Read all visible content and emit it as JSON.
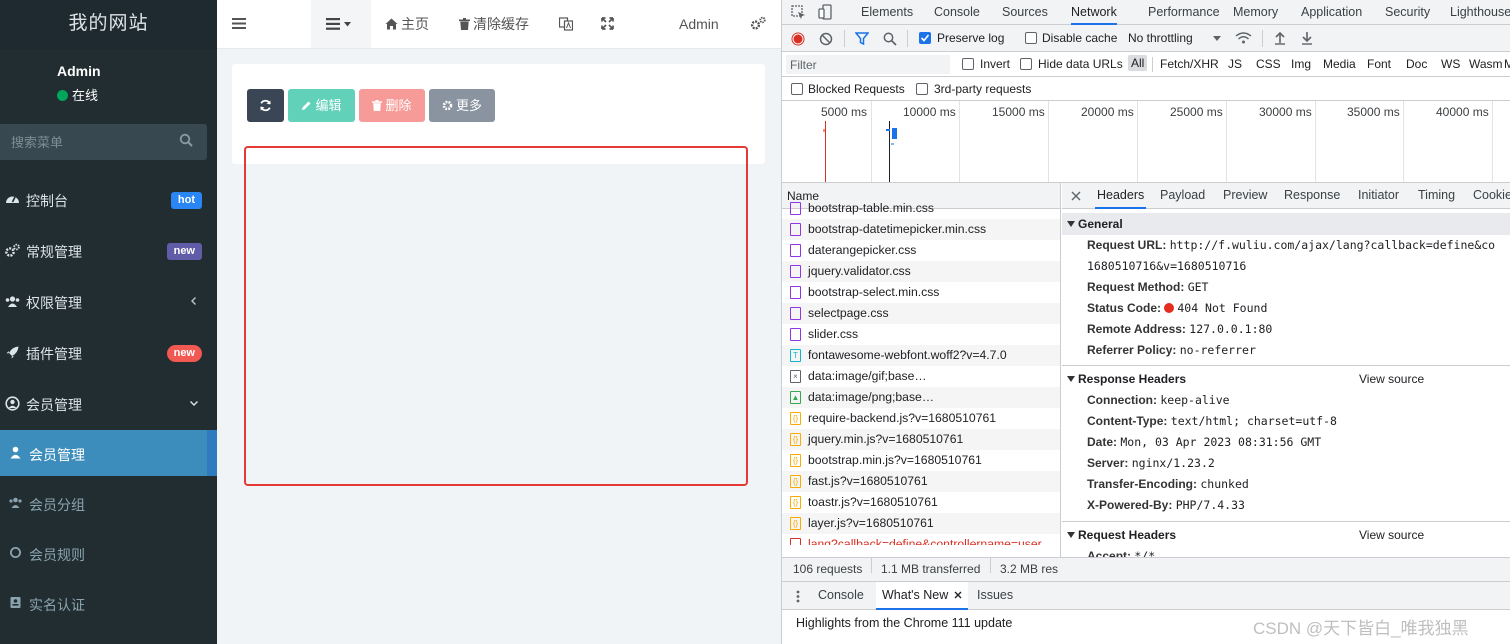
{
  "sidebar": {
    "logo": "我的网站",
    "user": {
      "name": "Admin",
      "status": "在线"
    },
    "search_placeholder": "搜索菜单",
    "items": [
      {
        "label": "控制台",
        "badge": "hot",
        "badge_color": "#2b86f5"
      },
      {
        "label": "常规管理",
        "badge": "new",
        "badge_color": "#605ca8"
      },
      {
        "label": "权限管理"
      },
      {
        "label": "插件管理",
        "badge": "new",
        "badge_color": "#f15952"
      },
      {
        "label": "会员管理"
      }
    ],
    "subitems": [
      {
        "label": "会员管理"
      },
      {
        "label": "会员分组"
      },
      {
        "label": "会员规则"
      },
      {
        "label": "实名认证"
      }
    ]
  },
  "topnav": {
    "home": "主页",
    "clear_cache": "清除缓存",
    "admin": "Admin"
  },
  "toolbar": {
    "edit": "编辑",
    "delete": "删除",
    "more": "更多"
  },
  "devtools": {
    "tabs": [
      "Elements",
      "Console",
      "Sources",
      "Network",
      "Performance",
      "Memory",
      "Application",
      "Security",
      "Lighthouse"
    ],
    "active_tab": "Network",
    "toolbar": {
      "preserve_log": "Preserve log",
      "disable_cache": "Disable cache",
      "throttling": "No throttling"
    },
    "filter": {
      "placeholder": "Filter",
      "invert": "Invert",
      "hide_data_urls": "Hide data URLs",
      "types": [
        "All",
        "Fetch/XHR",
        "JS",
        "CSS",
        "Img",
        "Media",
        "Font",
        "Doc",
        "WS",
        "Wasm",
        "Ma"
      ],
      "blocked": "Blocked Requests",
      "third_party": "3rd-party requests"
    },
    "timeline": [
      "5000 ms",
      "10000 ms",
      "15000 ms",
      "20000 ms",
      "25000 ms",
      "30000 ms",
      "35000 ms",
      "40000 ms"
    ],
    "requests_header": "Name",
    "requests": [
      {
        "name": "bootstrap-table.min.css",
        "kind": "css"
      },
      {
        "name": "bootstrap-datetimepicker.min.css",
        "kind": "css"
      },
      {
        "name": "daterangepicker.css",
        "kind": "css"
      },
      {
        "name": "jquery.validator.css",
        "kind": "css"
      },
      {
        "name": "bootstrap-select.min.css",
        "kind": "css"
      },
      {
        "name": "selectpage.css",
        "kind": "css"
      },
      {
        "name": "slider.css",
        "kind": "css"
      },
      {
        "name": "fontawesome-webfont.woff2?v=4.7.0",
        "kind": "font"
      },
      {
        "name": "data:image/gif;base…",
        "kind": "gif"
      },
      {
        "name": "data:image/png;base…",
        "kind": "png"
      },
      {
        "name": "require-backend.js?v=1680510761",
        "kind": "js"
      },
      {
        "name": "jquery.min.js?v=1680510761",
        "kind": "js"
      },
      {
        "name": "bootstrap.min.js?v=1680510761",
        "kind": "js"
      },
      {
        "name": "fast.js?v=1680510761",
        "kind": "js"
      },
      {
        "name": "toastr.js?v=1680510761",
        "kind": "js"
      },
      {
        "name": "layer.js?v=1680510761",
        "kind": "js"
      },
      {
        "name": "lang?callback=define&controllername=user....",
        "kind": "error"
      }
    ],
    "status_bar": {
      "requests": "106 requests",
      "transferred": "1.1 MB transferred",
      "resources": "3.2 MB res"
    },
    "detail_tabs": [
      "Headers",
      "Payload",
      "Preview",
      "Response",
      "Initiator",
      "Timing",
      "Cookies"
    ],
    "general": {
      "title": "General",
      "request_url_label": "Request URL:",
      "request_url": "http://f.wuliu.com/ajax/lang?callback=define&co",
      "request_url_cont": "1680510716&v=1680510716",
      "method_label": "Request Method:",
      "method": "GET",
      "status_label": "Status Code:",
      "status": "404 Not Found",
      "remote_label": "Remote Address:",
      "remote": "127.0.0.1:80",
      "referrer_label": "Referrer Policy:",
      "referrer": "no-referrer"
    },
    "response_headers": {
      "title": "Response Headers",
      "view_source": "View source",
      "items": [
        {
          "k": "Connection:",
          "v": "keep-alive"
        },
        {
          "k": "Content-Type:",
          "v": "text/html; charset=utf-8"
        },
        {
          "k": "Date:",
          "v": "Mon, 03 Apr 2023 08:31:56 GMT"
        },
        {
          "k": "Server:",
          "v": "nginx/1.23.2"
        },
        {
          "k": "Transfer-Encoding:",
          "v": "chunked"
        },
        {
          "k": "X-Powered-By:",
          "v": "PHP/7.4.33"
        }
      ]
    },
    "request_headers": {
      "title": "Request Headers",
      "view_source": "View source",
      "items": [
        {
          "k": "Accept:",
          "v": "*/*"
        }
      ]
    },
    "drawer": {
      "tabs": [
        "Console",
        "What's New",
        "Issues"
      ],
      "highlights": "Highlights from the Chrome 111 update"
    }
  },
  "watermark": "CSDN @天下皆白_唯我独黑"
}
